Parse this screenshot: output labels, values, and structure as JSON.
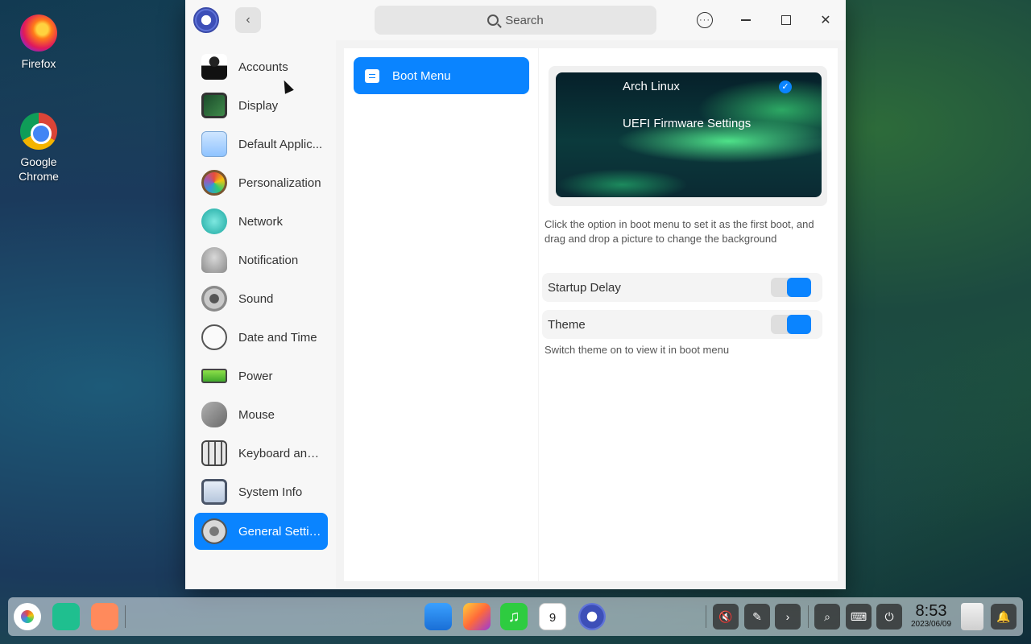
{
  "desktop": {
    "icons": [
      {
        "label": "Firefox"
      },
      {
        "label": "Google Chrome"
      }
    ]
  },
  "window": {
    "search_placeholder": "Search",
    "back_glyph": "‹",
    "menu_glyph": "···",
    "close_glyph": "✕"
  },
  "sidebar": {
    "items": [
      {
        "label": "Accounts",
        "icon": "accounts-icon"
      },
      {
        "label": "Display",
        "icon": "display-icon"
      },
      {
        "label": "Default Applic...",
        "icon": "default-apps-icon"
      },
      {
        "label": "Personalization",
        "icon": "personalization-icon"
      },
      {
        "label": "Network",
        "icon": "network-icon"
      },
      {
        "label": "Notification",
        "icon": "notification-icon"
      },
      {
        "label": "Sound",
        "icon": "sound-icon"
      },
      {
        "label": "Date and Time",
        "icon": "clock-icon"
      },
      {
        "label": "Power",
        "icon": "battery-icon"
      },
      {
        "label": "Mouse",
        "icon": "mouse-icon"
      },
      {
        "label": "Keyboard and ...",
        "icon": "keyboard-icon"
      },
      {
        "label": "System Info",
        "icon": "system-info-icon"
      },
      {
        "label": "General Settin...",
        "icon": "gear-icon",
        "active": true
      }
    ]
  },
  "submenu": {
    "items": [
      {
        "label": "Boot Menu",
        "active": true
      }
    ]
  },
  "boot": {
    "entries": [
      {
        "label": "Arch Linux",
        "selected": true
      },
      {
        "label": "UEFI Firmware Settings",
        "selected": false
      }
    ],
    "check_glyph": "✓",
    "hint": "Click the option in boot menu to set it as the first boot, and drag and drop a picture to change the background",
    "startup_delay": {
      "label": "Startup Delay",
      "on": true
    },
    "theme": {
      "label": "Theme",
      "on": true
    },
    "theme_hint": "Switch theme on to view it in boot menu"
  },
  "dock": {
    "apps": [
      "launcher-icon",
      "multitask-icon",
      "workspace-icon",
      "file-manager-icon",
      "image-viewer-icon",
      "music-icon",
      "calendar-icon",
      "control-center-icon"
    ],
    "calendar_day": "9",
    "tray_glyphs": {
      "volume": "🔇",
      "pen": "✎",
      "expand": "›",
      "search": "⌕",
      "keyboard": "⌨",
      "power": "⏻",
      "bell": "🔔"
    },
    "time": "8:53",
    "date": "2023/06/09"
  },
  "colors": {
    "accent": "#0a84ff"
  }
}
